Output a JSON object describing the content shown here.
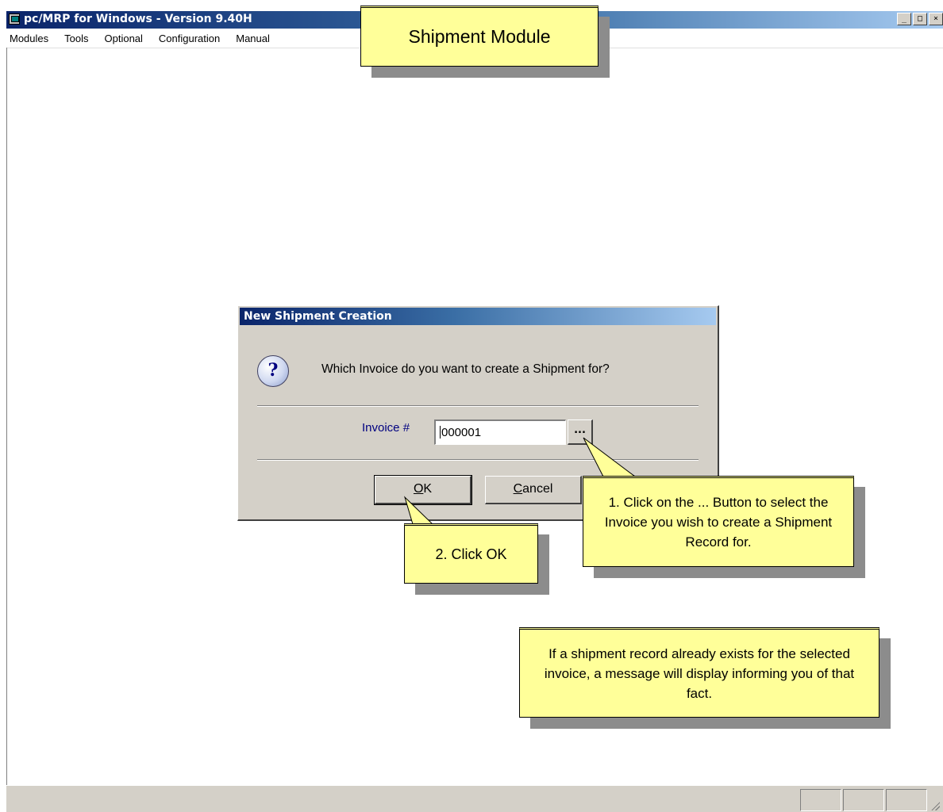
{
  "window": {
    "title": "pc/MRP for Windows - Version 9.40H",
    "controls": {
      "minimize": "_",
      "maximize": "□",
      "close": "×"
    }
  },
  "menu": [
    "Modules",
    "Tools",
    "Optional",
    "Configuration",
    "Manual"
  ],
  "callouts": {
    "module_title": "Shipment Module",
    "step1": "1. Click on the ... Button to select the Invoice you wish to create a Shipment Record for.",
    "step2": "2. Click OK",
    "note": "If a shipment record already exists for the selected invoice, a message will display informing you of that fact."
  },
  "dialog": {
    "title": "New Shipment Creation",
    "question_icon": "question-icon",
    "question": "Which Invoice do you want to create a Shipment for?",
    "invoice_label": "Invoice #",
    "invoice_value": "000001",
    "lookup_label": "...",
    "ok_mnemonic": "O",
    "ok_rest": "K",
    "cancel_mnemonic": "C",
    "cancel_rest": "ancel"
  },
  "colors": {
    "callout_fill": "#ffff99",
    "titlebar_start": "#0a246a",
    "titlebar_end": "#a6caf0",
    "dialog_face": "#d4d0c8",
    "label_blue": "#000080"
  }
}
